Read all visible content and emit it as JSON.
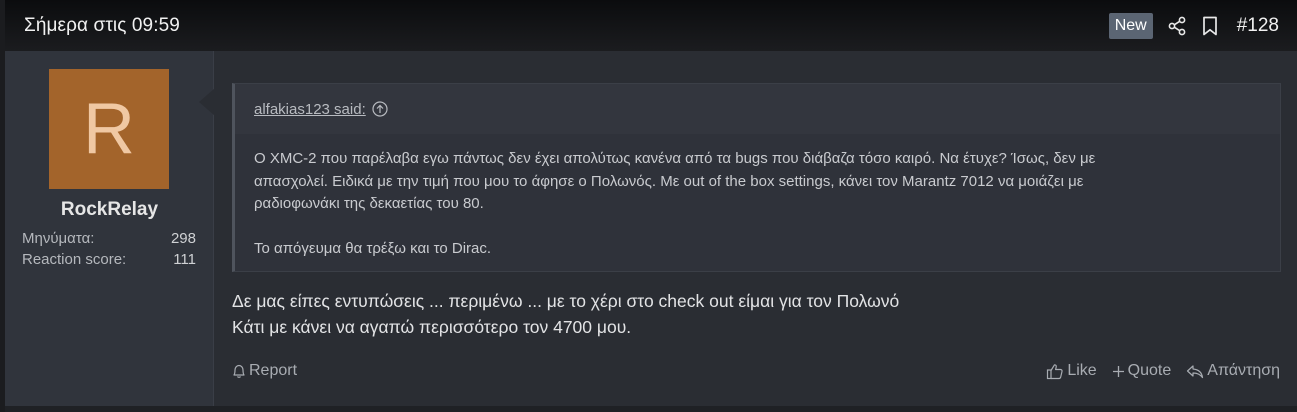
{
  "header": {
    "time": "Σήμερα στις 09:59",
    "new_badge": "New",
    "post_number": "#128",
    "icons": [
      "share-icon",
      "bookmark-icon"
    ]
  },
  "user": {
    "avatar_letter": "R",
    "avatar_color": "#a3642b",
    "username": "RockRelay",
    "stats": [
      {
        "label": "Μηνύματα:",
        "value": "298"
      },
      {
        "label": "Reaction score:",
        "value": "111"
      }
    ]
  },
  "quote": {
    "author": "alfakias123 said:",
    "lines": [
      "Ο XMC-2 που παρέλαβα εγω πάντως δεν έχει απολύτως κανένα από τα bugs που διάβαζα τόσο καιρό. Να έτυχε? Ίσως, δεν με",
      "απασχολεί. Ειδικά με την τιμή που μου το άφησε ο Πολωνός. Με out of the box settings, κάνει τον Marantz 7012 να μοιάζει με",
      "ραδιοφωνάκι της δεκαετίας του 80."
    ],
    "line2": "Το απόγευμα θα τρέξω και το Dirac."
  },
  "message": {
    "line1": "Δε μας είπες εντυπώσεις ... περιμένω ... με το χέρι στο check out είμαι για τον Πολωνό",
    "line2": "Κάτι με κάνει να αγαπώ περισσότερο τον 4700 μου."
  },
  "actions": {
    "report": "Report",
    "like": "Like",
    "quote": "Quote",
    "reply": "Απάντηση"
  }
}
